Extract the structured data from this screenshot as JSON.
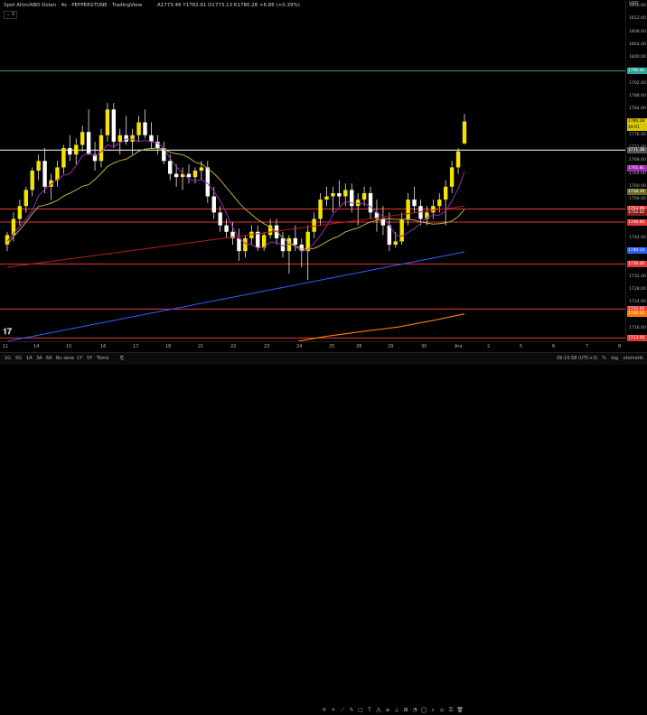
{
  "header": {
    "title": "Spot Altın/ABD Doları · 4s · PEPPERSTONE · TradingView",
    "ohlc": "A1773.46 Y1782.61 D1773.13 K1780.28 +6.86 (+0.39%)",
    "indicator_count": "3"
  },
  "price_axis": {
    "currency": "USD",
    "ticks": [
      "1816.00",
      "1812.00",
      "1808.00",
      "1804.00",
      "1800.00",
      "1796.00",
      "1792.00",
      "1788.00",
      "1784.00",
      "1780.00",
      "1776.00",
      "1772.00",
      "1768.00",
      "1764.00",
      "1760.00",
      "1756.00",
      "1752.00",
      "1748.00",
      "1744.00",
      "1740.00",
      "1736.00",
      "1732.00",
      "1728.00",
      "1724.00",
      "1720.00",
      "1716.00",
      "1712.00"
    ],
    "tags": [
      {
        "text": "1796.00",
        "color": "#26a69a"
      },
      {
        "text": "1780.28",
        "color": "#d8c600",
        "sub": "49:01"
      },
      {
        "text": "1771.38",
        "color": "#555555"
      },
      {
        "text": "1765.81",
        "color": "#9c27b0"
      },
      {
        "text": "1758.28",
        "color": "#6e6a1e"
      },
      {
        "text": "1753.09",
        "color": "#e53935"
      },
      {
        "text": "1752.02",
        "color": "#8b1d1d"
      },
      {
        "text": "1749.00",
        "color": "#e53935"
      },
      {
        "text": "1740.14",
        "color": "#2962ff"
      },
      {
        "text": "1736.00",
        "color": "#e53935"
      },
      {
        "text": "1722.00",
        "color": "#e53935"
      },
      {
        "text": "1720.52",
        "color": "#f57c00"
      },
      {
        "text": "1713.00",
        "color": "#e53935"
      }
    ]
  },
  "time_axis": {
    "labels": [
      "11",
      "14",
      "15",
      "16",
      "17",
      "18",
      "21",
      "22",
      "23",
      "24",
      "25",
      "28",
      "29",
      "30",
      "Ara",
      "2",
      "5",
      "6",
      "7",
      "8"
    ]
  },
  "bottom_bar": {
    "timeframes": [
      "1G",
      "5G",
      "1A",
      "3A",
      "6A",
      "Bu sene",
      "1Y",
      "5Y",
      "Tümü"
    ],
    "clock": "09:10:58 (UTC+3)",
    "opt_percent": "%",
    "opt_log": "log",
    "opt_auto": "otomatik"
  },
  "colors": {
    "bull": "#f5e400",
    "bear": "#ffffff",
    "wick": "#e6e6e6",
    "green_line": "#26a69a",
    "red_line": "#e53935",
    "white_line": "#ffffff",
    "ma_purple": "#9c27b0",
    "ma_olive": "#b8b04a",
    "ma_red": "#b71c1c",
    "ma_blue": "#2962ff",
    "ma_orange": "#f57c00"
  },
  "chart_data": {
    "type": "candlestick",
    "symbol": "Spot Altın/ABD Doları",
    "interval": "4s",
    "y_range": [
      1712,
      1818
    ],
    "horizontal_levels": [
      {
        "price": 1796.0,
        "color": "#26a69a"
      },
      {
        "price": 1771.38,
        "color": "#ffffff"
      },
      {
        "price": 1753.09,
        "color": "#e53935"
      },
      {
        "price": 1749.0,
        "color": "#e53935"
      },
      {
        "price": 1736.0,
        "color": "#e53935"
      },
      {
        "price": 1722.0,
        "color": "#e53935"
      },
      {
        "price": 1713.0,
        "color": "#e53935"
      }
    ],
    "candles": [
      [
        1742,
        1746,
        1740,
        1745
      ],
      [
        1745,
        1752,
        1743,
        1750
      ],
      [
        1750,
        1756,
        1748,
        1754
      ],
      [
        1754,
        1760,
        1752,
        1759
      ],
      [
        1759,
        1766,
        1757,
        1765
      ],
      [
        1765,
        1770,
        1762,
        1768
      ],
      [
        1768,
        1772,
        1758,
        1760
      ],
      [
        1760,
        1764,
        1756,
        1762
      ],
      [
        1762,
        1768,
        1760,
        1766
      ],
      [
        1766,
        1773,
        1764,
        1772
      ],
      [
        1772,
        1776,
        1768,
        1770
      ],
      [
        1770,
        1775,
        1767,
        1773
      ],
      [
        1773,
        1779,
        1771,
        1777
      ],
      [
        1777,
        1784,
        1775,
        1770
      ],
      [
        1770,
        1774,
        1765,
        1768
      ],
      [
        1768,
        1778,
        1766,
        1776
      ],
      [
        1776,
        1786,
        1774,
        1784
      ],
      [
        1784,
        1786,
        1772,
        1774
      ],
      [
        1774,
        1778,
        1770,
        1776
      ],
      [
        1776,
        1782,
        1773,
        1774
      ],
      [
        1774,
        1778,
        1770,
        1776
      ],
      [
        1776,
        1782,
        1774,
        1780
      ],
      [
        1780,
        1784,
        1775,
        1776
      ],
      [
        1776,
        1780,
        1772,
        1774
      ],
      [
        1774,
        1776,
        1770,
        1772
      ],
      [
        1772,
        1774,
        1767,
        1768
      ],
      [
        1768,
        1770,
        1762,
        1764
      ],
      [
        1764,
        1767,
        1760,
        1763
      ],
      [
        1763,
        1766,
        1759,
        1764
      ],
      [
        1764,
        1767,
        1761,
        1763
      ],
      [
        1763,
        1766,
        1761,
        1765
      ],
      [
        1765,
        1768,
        1762,
        1766
      ],
      [
        1766,
        1768,
        1755,
        1757
      ],
      [
        1757,
        1760,
        1750,
        1752
      ],
      [
        1752,
        1754,
        1746,
        1748
      ],
      [
        1748,
        1750,
        1744,
        1746
      ],
      [
        1746,
        1749,
        1742,
        1744
      ],
      [
        1744,
        1747,
        1737,
        1740
      ],
      [
        1740,
        1745,
        1738,
        1744
      ],
      [
        1744,
        1748,
        1742,
        1746
      ],
      [
        1746,
        1748,
        1740,
        1741
      ],
      [
        1741,
        1746,
        1740,
        1745
      ],
      [
        1745,
        1750,
        1744,
        1748
      ],
      [
        1748,
        1750,
        1742,
        1744
      ],
      [
        1744,
        1746,
        1738,
        1740
      ],
      [
        1740,
        1745,
        1733,
        1744
      ],
      [
        1744,
        1748,
        1740,
        1742
      ],
      [
        1742,
        1744,
        1735,
        1740
      ],
      [
        1740,
        1748,
        1731,
        1746
      ],
      [
        1746,
        1752,
        1744,
        1750
      ],
      [
        1750,
        1758,
        1748,
        1756
      ],
      [
        1756,
        1760,
        1754,
        1757
      ],
      [
        1757,
        1760,
        1752,
        1758
      ],
      [
        1758,
        1762,
        1754,
        1757
      ],
      [
        1757,
        1761,
        1754,
        1759
      ],
      [
        1759,
        1761,
        1752,
        1754
      ],
      [
        1754,
        1758,
        1748,
        1756
      ],
      [
        1756,
        1760,
        1754,
        1758
      ],
      [
        1758,
        1760,
        1750,
        1752
      ],
      [
        1752,
        1756,
        1746,
        1750
      ],
      [
        1750,
        1754,
        1745,
        1748
      ],
      [
        1748,
        1752,
        1740,
        1742
      ],
      [
        1742,
        1746,
        1741,
        1743
      ],
      [
        1743,
        1752,
        1742,
        1750
      ],
      [
        1750,
        1758,
        1748,
        1756
      ],
      [
        1756,
        1760,
        1752,
        1754
      ],
      [
        1754,
        1756,
        1748,
        1750
      ],
      [
        1750,
        1754,
        1748,
        1752
      ],
      [
        1752,
        1756,
        1750,
        1754
      ],
      [
        1754,
        1758,
        1752,
        1756
      ],
      [
        1756,
        1762,
        1748,
        1760
      ],
      [
        1760,
        1768,
        1758,
        1766
      ],
      [
        1766,
        1772,
        1764,
        1771
      ],
      [
        1773.46,
        1782.61,
        1773.13,
        1780.28
      ]
    ]
  }
}
